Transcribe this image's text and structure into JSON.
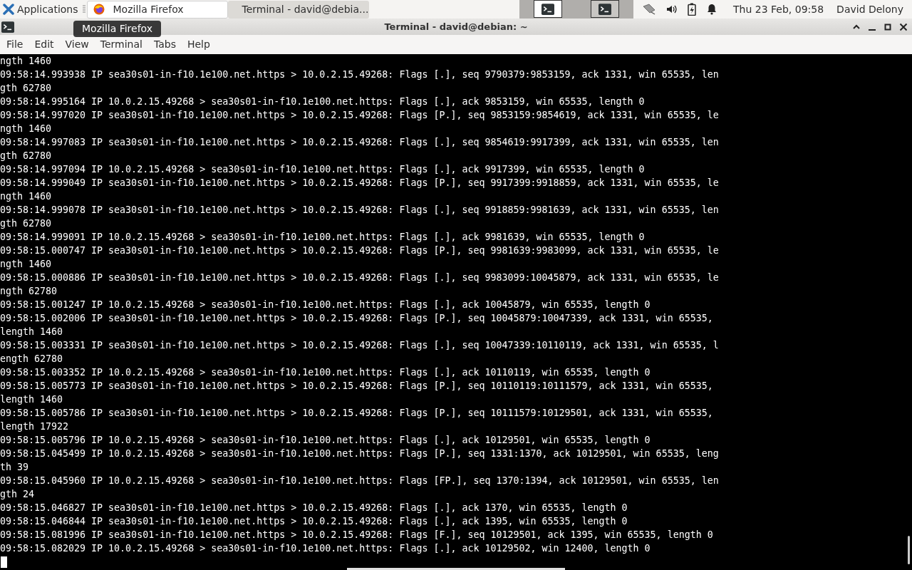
{
  "panel": {
    "menu_label": "Applications",
    "tasks": [
      {
        "label": "Mozilla Firefox",
        "kind": "browser",
        "selected": false
      },
      {
        "label": "Terminal - david@debia...",
        "kind": "terminal",
        "selected": true
      }
    ],
    "workspaces": [
      {
        "selected": false
      },
      {
        "selected": true
      }
    ],
    "clock": "Thu 23 Feb, 09:58",
    "user": "David Delony"
  },
  "tooltip": "Mozilla Firefox",
  "window": {
    "title": "Terminal - david@debian: ~"
  },
  "menu": [
    "File",
    "Edit",
    "View",
    "Terminal",
    "Tabs",
    "Help"
  ],
  "terminal_lines": [
    "ngth 1460",
    "09:58:14.993938 IP sea30s01-in-f10.1e100.net.https > 10.0.2.15.49268: Flags [.], seq 9790379:9853159, ack 1331, win 65535, len",
    "gth 62780",
    "09:58:14.995164 IP 10.0.2.15.49268 > sea30s01-in-f10.1e100.net.https: Flags [.], ack 9853159, win 65535, length 0",
    "09:58:14.997020 IP sea30s01-in-f10.1e100.net.https > 10.0.2.15.49268: Flags [P.], seq 9853159:9854619, ack 1331, win 65535, le",
    "ngth 1460",
    "09:58:14.997083 IP sea30s01-in-f10.1e100.net.https > 10.0.2.15.49268: Flags [.], seq 9854619:9917399, ack 1331, win 65535, len",
    "gth 62780",
    "09:58:14.997094 IP 10.0.2.15.49268 > sea30s01-in-f10.1e100.net.https: Flags [.], ack 9917399, win 65535, length 0",
    "09:58:14.999049 IP sea30s01-in-f10.1e100.net.https > 10.0.2.15.49268: Flags [P.], seq 9917399:9918859, ack 1331, win 65535, le",
    "ngth 1460",
    "09:58:14.999078 IP sea30s01-in-f10.1e100.net.https > 10.0.2.15.49268: Flags [.], seq 9918859:9981639, ack 1331, win 65535, len",
    "gth 62780",
    "09:58:14.999091 IP 10.0.2.15.49268 > sea30s01-in-f10.1e100.net.https: Flags [.], ack 9981639, win 65535, length 0",
    "09:58:15.000747 IP sea30s01-in-f10.1e100.net.https > 10.0.2.15.49268: Flags [P.], seq 9981639:9983099, ack 1331, win 65535, le",
    "ngth 1460",
    "09:58:15.000886 IP sea30s01-in-f10.1e100.net.https > 10.0.2.15.49268: Flags [.], seq 9983099:10045879, ack 1331, win 65535, le",
    "ngth 62780",
    "09:58:15.001247 IP 10.0.2.15.49268 > sea30s01-in-f10.1e100.net.https: Flags [.], ack 10045879, win 65535, length 0",
    "09:58:15.002006 IP sea30s01-in-f10.1e100.net.https > 10.0.2.15.49268: Flags [P.], seq 10045879:10047339, ack 1331, win 65535,",
    "length 1460",
    "09:58:15.003331 IP sea30s01-in-f10.1e100.net.https > 10.0.2.15.49268: Flags [.], seq 10047339:10110119, ack 1331, win 65535, l",
    "ength 62780",
    "09:58:15.003352 IP 10.0.2.15.49268 > sea30s01-in-f10.1e100.net.https: Flags [.], ack 10110119, win 65535, length 0",
    "09:58:15.005773 IP sea30s01-in-f10.1e100.net.https > 10.0.2.15.49268: Flags [P.], seq 10110119:10111579, ack 1331, win 65535,",
    "length 1460",
    "09:58:15.005786 IP sea30s01-in-f10.1e100.net.https > 10.0.2.15.49268: Flags [P.], seq 10111579:10129501, ack 1331, win 65535,",
    "length 17922",
    "09:58:15.005796 IP 10.0.2.15.49268 > sea30s01-in-f10.1e100.net.https: Flags [.], ack 10129501, win 65535, length 0",
    "09:58:15.045499 IP 10.0.2.15.49268 > sea30s01-in-f10.1e100.net.https: Flags [P.], seq 1331:1370, ack 10129501, win 65535, leng",
    "th 39",
    "09:58:15.045960 IP 10.0.2.15.49268 > sea30s01-in-f10.1e100.net.https: Flags [FP.], seq 1370:1394, ack 10129501, win 65535, len",
    "gth 24",
    "09:58:15.046827 IP sea30s01-in-f10.1e100.net.https > 10.0.2.15.49268: Flags [.], ack 1370, win 65535, length 0",
    "09:58:15.046844 IP sea30s01-in-f10.1e100.net.https > 10.0.2.15.49268: Flags [.], ack 1395, win 65535, length 0",
    "09:58:15.081996 IP sea30s01-in-f10.1e100.net.https > 10.0.2.15.49268: Flags [F.], seq 10129501, ack 1395, win 65535, length 0",
    "09:58:15.082029 IP 10.0.2.15.49268 > sea30s01-in-f10.1e100.net.https: Flags [.], ack 10129502, win 12400, length 0"
  ]
}
